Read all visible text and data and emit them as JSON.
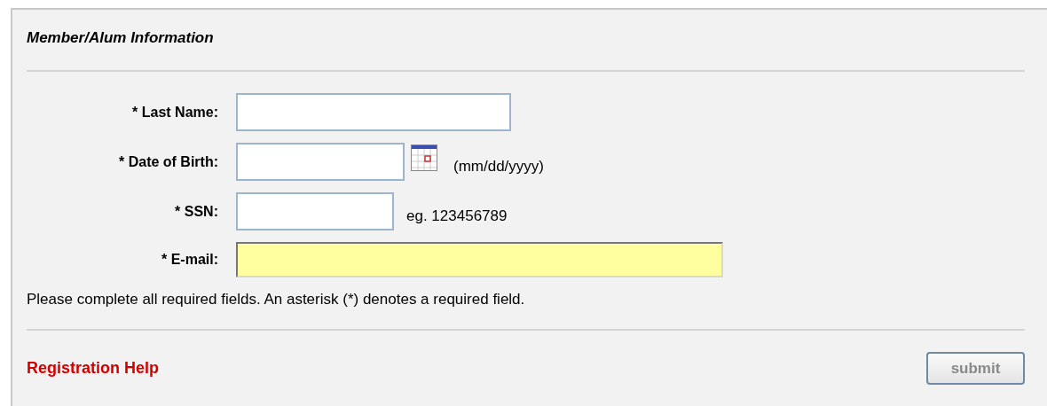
{
  "panel": {
    "title": "Member/Alum Information"
  },
  "fields": [
    {
      "kind": "text",
      "label": "* Last Name:",
      "highlighted": false
    },
    {
      "kind": "date",
      "label": "* Date of Birth:",
      "hint": "(mm/dd/yyyy)",
      "highlighted": false
    },
    {
      "kind": "text",
      "label": "* SSN:",
      "hint": "eg. 123456789",
      "highlighted": false
    },
    {
      "kind": "text",
      "label": "* E-mail:",
      "highlighted": true
    }
  ],
  "note": "Please complete all required fields. An asterisk (*) denotes a required field.",
  "help_link": "Registration Help",
  "submit": {
    "label": "submit",
    "disabled": true
  }
}
